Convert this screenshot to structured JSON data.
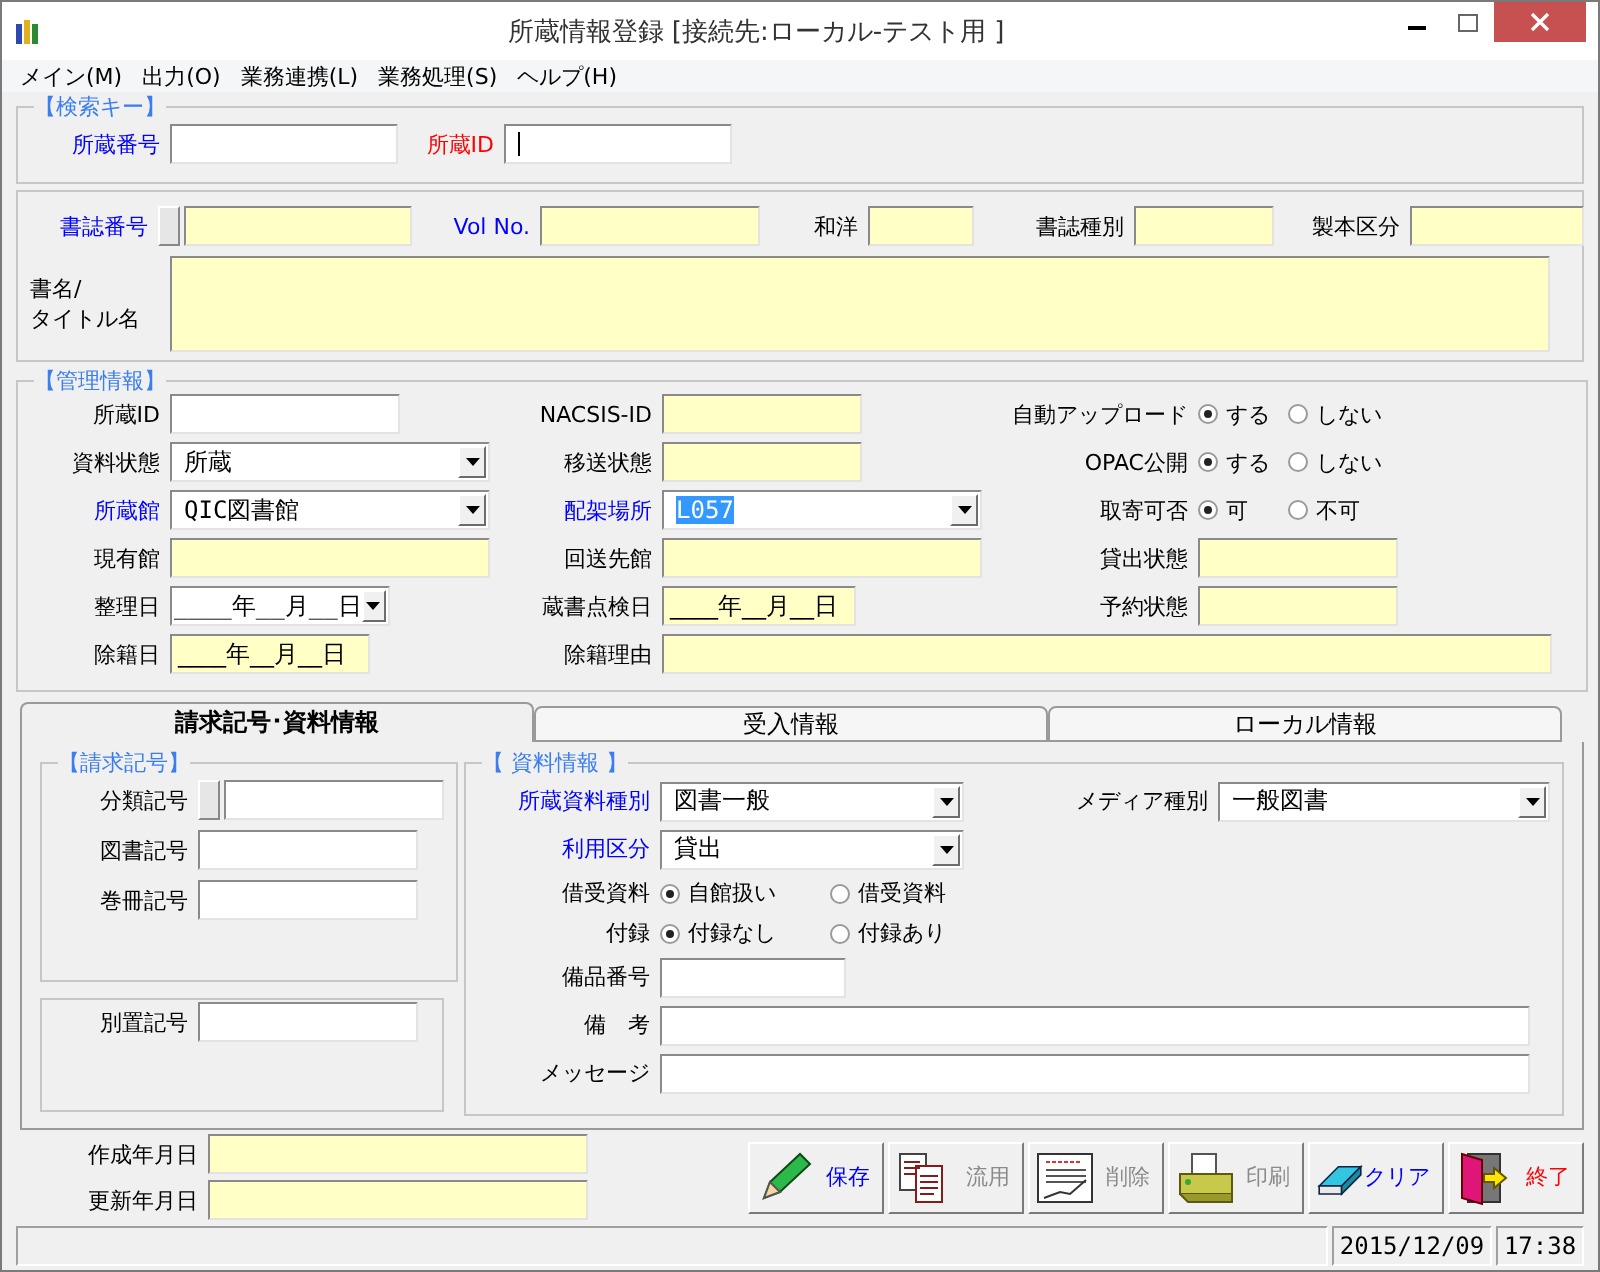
{
  "window": {
    "title": "所蔵情報登録 [接続先:ローカル-テスト用 ]"
  },
  "menu": [
    "メイン(M)",
    "出力(O)",
    "業務連携(L)",
    "業務処理(S)",
    "ヘルプ(H)"
  ],
  "search": {
    "title": "【検索キー】",
    "fields": [
      {
        "label": "所蔵番号",
        "color": "#0000ff",
        "kind": "text",
        "readonly": false
      },
      {
        "label": "所蔵ID",
        "color": "#ff0000",
        "kind": "text",
        "readonly": false,
        "focused": true
      }
    ]
  },
  "biblio": {
    "fields": [
      {
        "label": "書誌番号",
        "color": "#0000ff",
        "kind": "text",
        "readonly": true,
        "has_button": true
      },
      {
        "label": "Vol No.",
        "color": "#0000ff",
        "kind": "text",
        "readonly": true
      },
      {
        "label": "和洋",
        "kind": "text",
        "readonly": true
      },
      {
        "label": "書誌種別",
        "kind": "text",
        "readonly": true
      },
      {
        "label": "製本区分",
        "kind": "text",
        "readonly": true
      }
    ],
    "title_field": {
      "label": "書名/\nタイトル名",
      "kind": "textarea",
      "readonly": true
    }
  },
  "management": {
    "title": "【管理情報】",
    "rows": [
      {
        "left": {
          "label": "所蔵ID",
          "kind": "text",
          "readonly": false
        },
        "middle": {
          "label": "NACSIS-ID",
          "kind": "text",
          "readonly": true
        },
        "right": {
          "label": "自動アップロード",
          "kind": "radio",
          "options": [
            {
              "label": "する",
              "selected": true
            },
            {
              "label": "しない",
              "selected": false
            }
          ]
        }
      },
      {
        "left": {
          "label": "資料状態",
          "kind": "select",
          "value": "所蔵"
        },
        "middle": {
          "label": "移送状態",
          "kind": "text",
          "readonly": true
        },
        "right": {
          "label": "OPAC公開",
          "kind": "radio",
          "options": [
            {
              "label": "する",
              "selected": true
            },
            {
              "label": "しない",
              "selected": false
            }
          ]
        }
      },
      {
        "left": {
          "label": "所蔵館",
          "color": "#0000ff",
          "kind": "select",
          "value": "QIC図書館"
        },
        "middle": {
          "label": "配架場所",
          "color": "#0000ff",
          "kind": "select",
          "value": "L057",
          "highlighted": true
        },
        "right": {
          "label": "取寄可否",
          "kind": "radio",
          "options": [
            {
              "label": "可",
              "selected": true
            },
            {
              "label": "不可",
              "selected": false
            }
          ]
        }
      },
      {
        "left": {
          "label": "現有館",
          "kind": "text",
          "readonly": true
        },
        "middle": {
          "label": "回送先館",
          "kind": "text",
          "readonly": true
        },
        "right": {
          "label": "貸出状態",
          "kind": "text",
          "readonly": true
        }
      },
      {
        "left": {
          "label": "整理日",
          "kind": "date-select",
          "value": "____年__月__日"
        },
        "middle": {
          "label": "蔵書点検日",
          "kind": "text",
          "readonly": true,
          "value": "____年__月__日"
        },
        "right": {
          "label": "予約状態",
          "kind": "text",
          "readonly": true
        }
      },
      {
        "left": {
          "label": "除籍日",
          "kind": "text",
          "readonly": true,
          "value": "____年__月__日"
        },
        "middle": {
          "label": "除籍理由",
          "kind": "text",
          "readonly": true
        }
      }
    ]
  },
  "tabs": [
    {
      "label": "請求記号･資料情報",
      "selected": true
    },
    {
      "label": "受入情報",
      "selected": false
    },
    {
      "label": "ローカル情報",
      "selected": false
    }
  ],
  "claim": {
    "title": "【請求記号】",
    "fields": [
      {
        "label": "分類記号",
        "kind": "text",
        "readonly": false,
        "has_button": true
      },
      {
        "label": "図書記号",
        "kind": "text",
        "readonly": false
      },
      {
        "label": "巻冊記号",
        "kind": "text",
        "readonly": false
      }
    ],
    "separate": {
      "label": "別置記号",
      "kind": "text",
      "readonly": false
    }
  },
  "material": {
    "title": "【 資料情報 】",
    "rows": [
      [
        {
          "label": "所蔵資料種別",
          "color": "#0000ff",
          "kind": "select",
          "value": "図書一般"
        },
        {
          "label": "メディア種別",
          "kind": "select",
          "value": "一般図書"
        }
      ],
      [
        {
          "label": "利用区分",
          "color": "#0000ff",
          "kind": "select",
          "value": "貸出"
        }
      ],
      [
        {
          "label": "借受資料",
          "kind": "radio",
          "options": [
            {
              "label": "自館扱い",
              "selected": true
            },
            {
              "label": "借受資料",
              "selected": false
            }
          ]
        }
      ],
      [
        {
          "label": "付録",
          "kind": "radio",
          "options": [
            {
              "label": "付録なし",
              "selected": true
            },
            {
              "label": "付録あり",
              "selected": false
            }
          ]
        }
      ],
      [
        {
          "label": "備品番号",
          "kind": "text",
          "readonly": false
        }
      ],
      [
        {
          "label": "備　考",
          "kind": "text",
          "readonly": false
        }
      ],
      [
        {
          "label": "メッセージ",
          "kind": "text",
          "readonly": false
        }
      ]
    ]
  },
  "footer": [
    {
      "label": "作成年月日",
      "kind": "text",
      "readonly": true
    },
    {
      "label": "更新年月日",
      "kind": "text",
      "readonly": true
    }
  ],
  "buttons": [
    {
      "label": "保存",
      "color": "#0000ff",
      "disabled": false
    },
    {
      "label": "流用",
      "disabled": true
    },
    {
      "label": "削除",
      "disabled": true
    },
    {
      "label": "印刷",
      "disabled": true
    },
    {
      "label": "クリア",
      "color": "#0000ff",
      "disabled": false
    },
    {
      "label": "終了",
      "color": "#ff0000",
      "disabled": false
    }
  ],
  "status_bar": {
    "date": "2015/12/09",
    "time": "17:38"
  }
}
